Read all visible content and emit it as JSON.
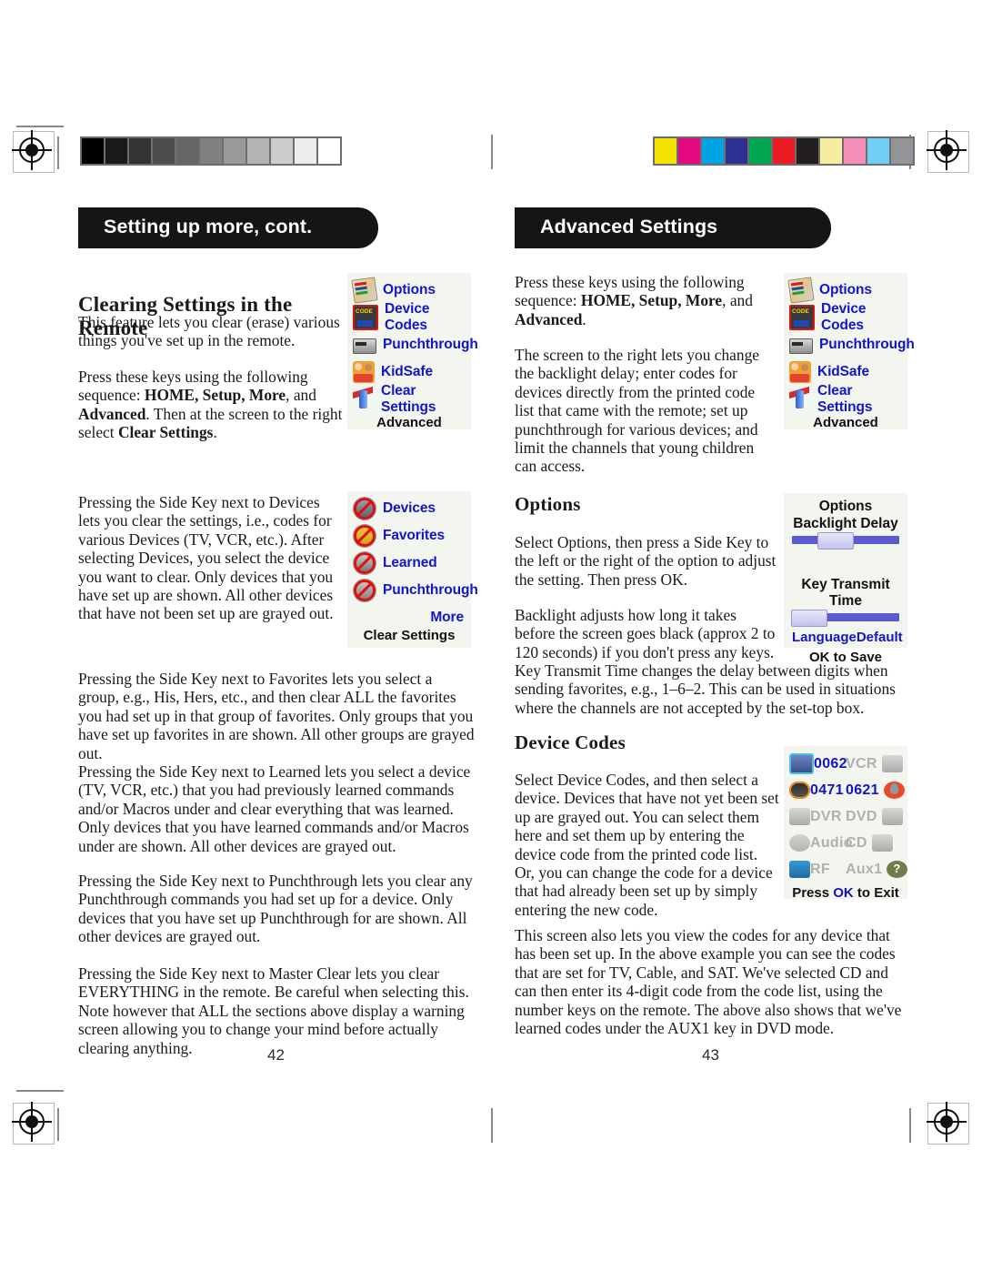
{
  "document": {
    "left_page_number": "42",
    "right_page_number": "43"
  },
  "print_marks": {
    "grayscale_wedge": [
      "#000000",
      "#1a1a1a",
      "#333333",
      "#4d4d4d",
      "#666666",
      "#808080",
      "#999999",
      "#b3b3b3",
      "#cccccc",
      "#ececec",
      "#ffffff"
    ],
    "color_wedge": [
      "#f5e400",
      "#e3097e",
      "#00a4e4",
      "#2e3192",
      "#00a651",
      "#ed1c24",
      "#231f20",
      "#f5eda0",
      "#f490b8",
      "#6fcff6",
      "#939598"
    ]
  },
  "left_page": {
    "banner": "Setting up more, cont.",
    "heading": "Clearing Settings in the Remote",
    "paragraphs": [
      "This feature lets you clear (erase) various things you've set up in the remote.",
      "Pressing the Side Key next to Devices lets you clear the settings, i.e., codes for various Devices (TV, VCR, etc.). After selecting Devices, you select the device you want to clear. Only devices that you have set up are shown. All other devices that have not been set up are grayed out.",
      "Pressing the Side Key next to Favorites lets you select a group, e.g., His, Hers, etc., and then clear ALL the favorites you had set up in that group of favorites. Only groups that you have set up favorites in are shown. All other groups are grayed out.",
      "Pressing the Side Key next to Learned lets you select a device (TV, VCR, etc.) that you had previously learned commands and/or Macros under and clear everything that was learned. Only devices that you have learned commands and/or Macros under are shown. All other devices are grayed out.",
      "Pressing the Side Key next to Punchthrough lets you clear any Punchthrough commands you had set up for a device. Only devices that you have set up Punchthrough for are shown. All other devices are grayed out.",
      "Pressing the Side Key next to Master Clear lets you clear EVERYTHING in the remote. Be careful when selecting this. Note however that ALL the sections above display a warning screen allowing you to change your mind before actually clearing anything."
    ],
    "key_sequence_paragraph": {
      "prefix": "Press these keys using the following sequence: ",
      "keys": "HOME, Setup, More",
      "middle": ", and ",
      "last_key": "Advanced",
      "suffix": ". Then at the screen to the right select ",
      "selection": "Clear Settings",
      "end": "."
    },
    "advanced_menu_screen": {
      "items": [
        {
          "label": "Options",
          "icon": "options-icon"
        },
        {
          "label": "Device Codes",
          "icon": "device-codes-icon"
        },
        {
          "label": "Punchthrough",
          "icon": "punchthrough-icon"
        },
        {
          "label": "KidSafe",
          "icon": "kidsafe-icon"
        },
        {
          "label": "Clear Settings",
          "icon": "clear-settings-icon"
        }
      ],
      "footer": "Advanced"
    },
    "clear_settings_screen": {
      "items": [
        {
          "label": "Devices",
          "icon": "no-devices-icon"
        },
        {
          "label": "Favorites",
          "icon": "no-favorites-icon"
        },
        {
          "label": "Learned",
          "icon": "no-learned-icon"
        },
        {
          "label": "Punchthrough",
          "icon": "no-punchthrough-icon"
        }
      ],
      "more": "More",
      "footer": "Clear Settings"
    }
  },
  "right_page": {
    "banner": "Advanced Settings",
    "key_sequence_paragraph": {
      "prefix": "Press these keys using the following sequence: ",
      "keys": "HOME, Setup, More",
      "middle": ", and ",
      "last_key": "Advanced",
      "end": "."
    },
    "intro_paragraph": "The screen to the right lets you change the backlight delay; enter codes for devices directly from the printed code list that came with the remote; set up punchthrough for various devices; and limit the channels that young children can access.",
    "options_section": {
      "heading": "Options",
      "paragraphs": [
        "Select Options, then press a Side Key to the left or the right of the option to adjust the setting. Then press OK.",
        "Backlight adjusts how long it takes before the screen goes black (approx 2 to 120 seconds) if you don't press any keys.",
        "Key Transmit Time changes the delay between digits when sending favorites, e.g., 1–6–2. This can be used in situations where the channels are not accepted by the set-top box."
      ]
    },
    "device_codes_section": {
      "heading": "Device Codes",
      "paragraphs": [
        "Select Device Codes, and then select a device. Devices that have not yet been set up are grayed out. You can select them here and set them up by entering the device code from the printed code list. Or, you can change the code for a device that had already been set up by simply entering the new code.",
        "This screen also lets you view the codes for any device that has been set up. In the above example you can see the codes that are set for TV, Cable, and SAT. We've selected CD and can then enter its 4-digit code from the code list, using the number keys on the remote. The above also shows that we've learned codes under the AUX1 key in DVD mode."
      ]
    },
    "advanced_menu_screen": {
      "items": [
        {
          "label": "Options",
          "icon": "options-icon"
        },
        {
          "label": "Device Codes",
          "icon": "device-codes-icon"
        },
        {
          "label": "Punchthrough",
          "icon": "punchthrough-icon"
        },
        {
          "label": "KidSafe",
          "icon": "kidsafe-icon"
        },
        {
          "label": "Clear Settings",
          "icon": "clear-settings-icon"
        }
      ],
      "footer": "Advanced"
    },
    "options_screen": {
      "title": "Options",
      "backlight_label": "Backlight Delay",
      "backlight_value_pct": 40,
      "key_transmit_label": "Key Transmit Time",
      "key_transmit_value_pct": 15,
      "language_link": "Language",
      "default_link": "Default",
      "footer": "OK to Save"
    },
    "device_codes_screen": {
      "rows": [
        {
          "left_icon": "tv-icon",
          "left_text": "0062",
          "left_active": true,
          "right_text": "VCR",
          "right_icon": "vcr-icon",
          "right_active": false
        },
        {
          "left_icon": "cable-icon",
          "left_text": "0471",
          "left_active": true,
          "right_text": "0621",
          "right_icon": "sat-icon",
          "right_active": true
        },
        {
          "left_icon": "dvr-icon",
          "left_text": "DVR",
          "left_active": false,
          "right_text": "DVD",
          "right_icon": "dvd-icon",
          "right_active": false
        },
        {
          "left_icon": "audio-icon",
          "left_text": "Audio",
          "left_active": false,
          "right_text": "CD",
          "right_icon": "cd-icon",
          "right_active": false
        },
        {
          "left_icon": "rf-icon",
          "left_text": "RF",
          "left_active": false,
          "right_text": "Aux1",
          "right_icon": "aux1-icon",
          "right_active": false
        }
      ],
      "footer_prefix": "Press ",
      "footer_key": "OK",
      "footer_suffix": " to Exit"
    }
  }
}
